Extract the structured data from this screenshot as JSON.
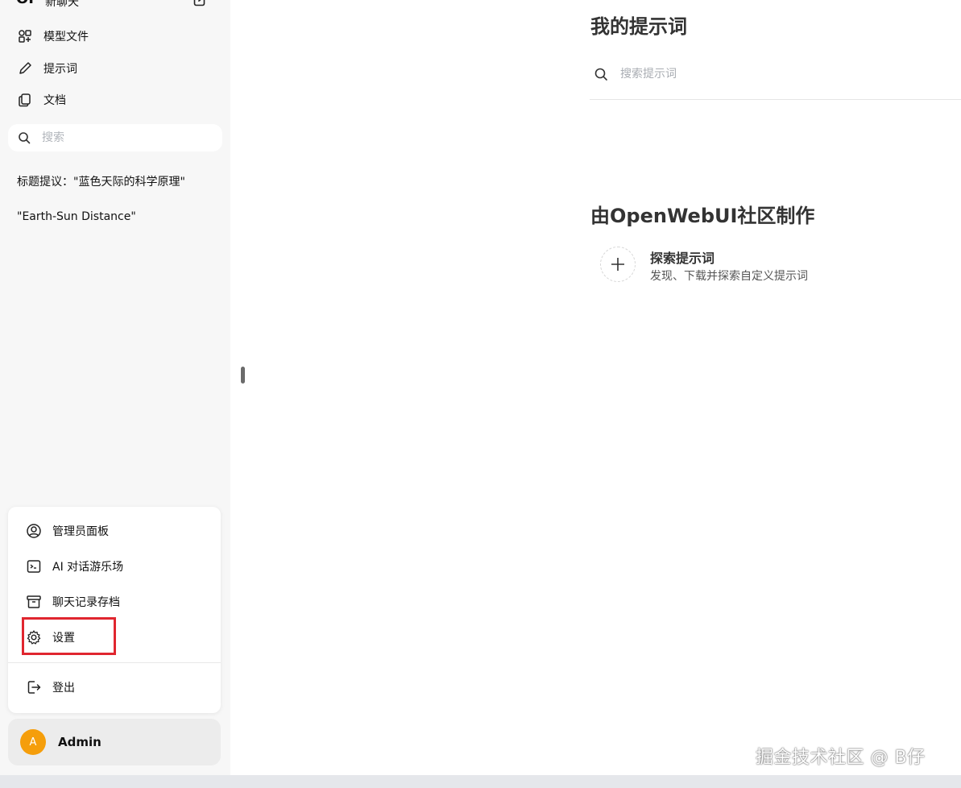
{
  "sidebar": {
    "logo": "OI",
    "new_chat_label": "新聊天",
    "nav": {
      "models": "模型文件",
      "prompts": "提示词",
      "documents": "文档"
    },
    "search_placeholder": "搜索",
    "chats": [
      "标题提议：\"蓝色天际的科学原理\"",
      "\"Earth-Sun Distance\""
    ]
  },
  "user_menu": {
    "admin_panel": "管理员面板",
    "playground": "AI 对话游乐场",
    "archived_chats": "聊天记录存档",
    "settings": "设置",
    "logout": "登出"
  },
  "user": {
    "avatar_initial": "A",
    "name": "Admin",
    "avatar_color": "#f59e0b"
  },
  "main": {
    "title": "我的提示词",
    "search_placeholder": "搜索提示词",
    "community_title": "由OpenWebUI社区制作",
    "discover": {
      "title": "探索提示词",
      "subtitle": "发现、下载并探索自定义提示词"
    }
  },
  "watermark": "掘金技术社区 @ B仔",
  "colors": {
    "highlight": "#e0262f",
    "sidebar_bg": "#f7f7f7"
  }
}
